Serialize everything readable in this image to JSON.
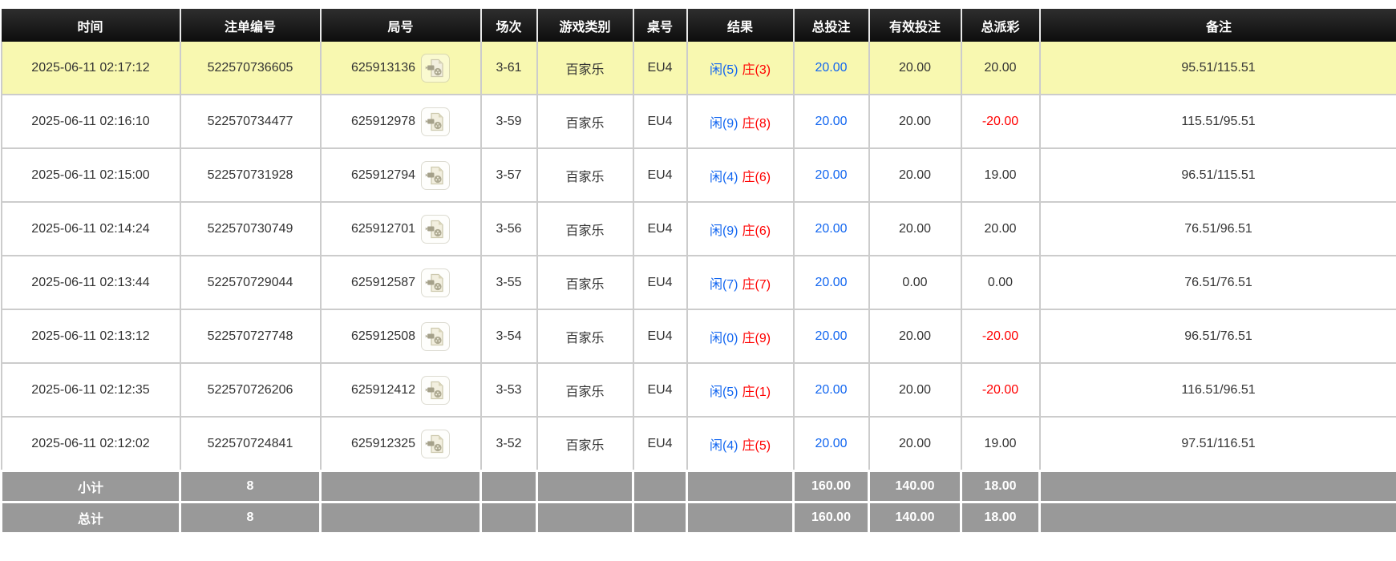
{
  "table": {
    "columns": [
      {
        "key": "time",
        "label": "时间"
      },
      {
        "key": "bet_id",
        "label": "注单编号"
      },
      {
        "key": "round_id",
        "label": "局号"
      },
      {
        "key": "session",
        "label": "场次"
      },
      {
        "key": "game_type",
        "label": "游戏类别"
      },
      {
        "key": "table_no",
        "label": "桌号"
      },
      {
        "key": "result",
        "label": "结果"
      },
      {
        "key": "total_bet",
        "label": "总投注"
      },
      {
        "key": "valid_bet",
        "label": "有效投注"
      },
      {
        "key": "payout",
        "label": "总派彩"
      },
      {
        "key": "note",
        "label": "备注"
      }
    ],
    "rows": [
      {
        "time": "2025-06-11 02:17:12",
        "bet_id": "522570736605",
        "round_id": "625913136",
        "session": "3-61",
        "game_type": "百家乐",
        "table_no": "EU4",
        "result_player": "闲(5)",
        "result_banker": "庄(3)",
        "total_bet": "20.00",
        "valid_bet": "20.00",
        "payout": "20.00",
        "note": "95.51/115.51",
        "highlighted": true
      },
      {
        "time": "2025-06-11 02:16:10",
        "bet_id": "522570734477",
        "round_id": "625912978",
        "session": "3-59",
        "game_type": "百家乐",
        "table_no": "EU4",
        "result_player": "闲(9)",
        "result_banker": "庄(8)",
        "total_bet": "20.00",
        "valid_bet": "20.00",
        "payout": "-20.00",
        "note": "115.51/95.51",
        "highlighted": false
      },
      {
        "time": "2025-06-11 02:15:00",
        "bet_id": "522570731928",
        "round_id": "625912794",
        "session": "3-57",
        "game_type": "百家乐",
        "table_no": "EU4",
        "result_player": "闲(4)",
        "result_banker": "庄(6)",
        "total_bet": "20.00",
        "valid_bet": "20.00",
        "payout": "19.00",
        "note": "96.51/115.51",
        "highlighted": false
      },
      {
        "time": "2025-06-11 02:14:24",
        "bet_id": "522570730749",
        "round_id": "625912701",
        "session": "3-56",
        "game_type": "百家乐",
        "table_no": "EU4",
        "result_player": "闲(9)",
        "result_banker": "庄(6)",
        "total_bet": "20.00",
        "valid_bet": "20.00",
        "payout": "20.00",
        "note": "76.51/96.51",
        "highlighted": false
      },
      {
        "time": "2025-06-11 02:13:44",
        "bet_id": "522570729044",
        "round_id": "625912587",
        "session": "3-55",
        "game_type": "百家乐",
        "table_no": "EU4",
        "result_player": "闲(7)",
        "result_banker": "庄(7)",
        "total_bet": "20.00",
        "valid_bet": "0.00",
        "payout": "0.00",
        "note": "76.51/76.51",
        "highlighted": false
      },
      {
        "time": "2025-06-11 02:13:12",
        "bet_id": "522570727748",
        "round_id": "625912508",
        "session": "3-54",
        "game_type": "百家乐",
        "table_no": "EU4",
        "result_player": "闲(0)",
        "result_banker": "庄(9)",
        "total_bet": "20.00",
        "valid_bet": "20.00",
        "payout": "-20.00",
        "note": "96.51/76.51",
        "highlighted": false
      },
      {
        "time": "2025-06-11 02:12:35",
        "bet_id": "522570726206",
        "round_id": "625912412",
        "session": "3-53",
        "game_type": "百家乐",
        "table_no": "EU4",
        "result_player": "闲(5)",
        "result_banker": "庄(1)",
        "total_bet": "20.00",
        "valid_bet": "20.00",
        "payout": "-20.00",
        "note": "116.51/96.51",
        "highlighted": false
      },
      {
        "time": "2025-06-11 02:12:02",
        "bet_id": "522570724841",
        "round_id": "625912325",
        "session": "3-52",
        "game_type": "百家乐",
        "table_no": "EU4",
        "result_player": "闲(4)",
        "result_banker": "庄(5)",
        "total_bet": "20.00",
        "valid_bet": "20.00",
        "payout": "19.00",
        "note": "97.51/116.51",
        "highlighted": false
      }
    ],
    "subtotal": {
      "label": "小计",
      "count": "8",
      "total_bet": "160.00",
      "valid_bet": "140.00",
      "payout": "18.00"
    },
    "grand_total": {
      "label": "总计",
      "count": "8",
      "total_bet": "160.00",
      "valid_bet": "140.00",
      "payout": "18.00"
    }
  },
  "icons": {
    "video_replay": "video-replay-icon"
  },
  "colors": {
    "header_bg": "#141414",
    "header_text": "#ffffff",
    "highlight_row": "#f8f8b0",
    "summary_bg": "#999999",
    "accent_blue": "#1266f0",
    "accent_red": "#ff0000",
    "border": "#cccccc",
    "body_text": "#333333"
  }
}
